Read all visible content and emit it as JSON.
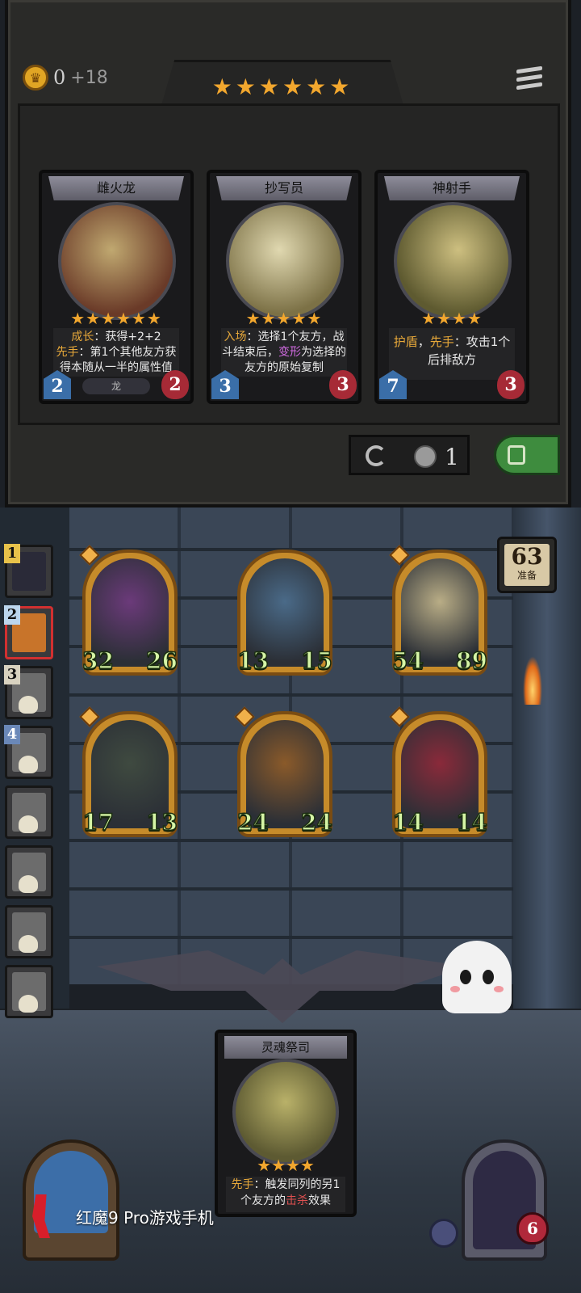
{
  "header": {
    "gold": "0",
    "gold_income": "+18",
    "tier_stars": "★★★★★★"
  },
  "shop_cards": [
    {
      "name": "雌火龙",
      "stars": "★★★★★★",
      "desc_kw1": "成长",
      "desc_t1": "：获得+2+2",
      "desc_kw2": "先手",
      "desc_t2": "：第1个其他友方获得本随从一半的属性值",
      "attack": "2",
      "health": "2",
      "tribe": "龙"
    },
    {
      "name": "抄写员",
      "stars": "★★★★★",
      "desc_kw1": "入场",
      "desc_t1": "：选择1个友方，战斗结束后，",
      "desc_kw2": "变形",
      "desc_t2": "为选择的友方的原始复制",
      "attack": "3",
      "health": "3",
      "tribe": ""
    },
    {
      "name": "神射手",
      "stars": "★★★★",
      "desc_kw1": "护盾",
      "desc_t1": "，",
      "desc_kw2": "先手",
      "desc_t2": "：攻击1个后排敌方",
      "attack": "7",
      "health": "3",
      "tribe": ""
    }
  ],
  "shop_controls": {
    "refresh_cost": "1",
    "refresh_icon": "refresh-icon",
    "lock_icon": "lock-icon"
  },
  "round": {
    "number": "63",
    "label": "准备"
  },
  "roster": [
    {
      "rank": "1",
      "state": "alive"
    },
    {
      "rank": "2",
      "state": "alive-current"
    },
    {
      "rank": "3",
      "state": "dead"
    },
    {
      "rank": "4",
      "state": "dead"
    },
    {
      "rank": "",
      "state": "dead"
    },
    {
      "rank": "",
      "state": "dead"
    },
    {
      "rank": "",
      "state": "dead"
    },
    {
      "rank": "",
      "state": "dead"
    }
  ],
  "board": [
    {
      "attack": "32",
      "health": "26",
      "color": "#6b3a7a"
    },
    {
      "attack": "13",
      "health": "15",
      "color": "#4a6a88"
    },
    {
      "attack": "54",
      "health": "89",
      "color": "#b9ad86"
    },
    {
      "attack": "17",
      "health": "13",
      "color": "#3f4a40"
    },
    {
      "attack": "24",
      "health": "24",
      "color": "#8a5a2a"
    },
    {
      "attack": "14",
      "health": "14",
      "color": "#8a2a3a"
    }
  ],
  "hand_card": {
    "name": "灵魂祭司",
    "stars": "★★★★",
    "desc_kw1": "先手",
    "desc_t1": "：触发同列的另1个友方的",
    "desc_kw2": "击杀",
    "desc_t2": "效果"
  },
  "hero": {
    "health": "6"
  },
  "watermark": "红魔9 Pro游戏手机"
}
